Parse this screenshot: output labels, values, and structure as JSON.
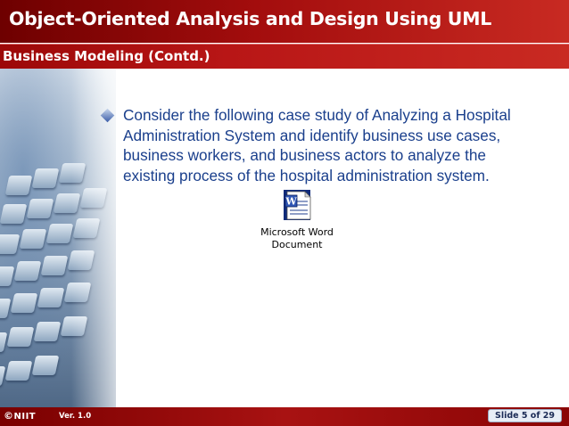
{
  "header": {
    "title": "Object-Oriented Analysis and Design Using UML",
    "subtitle": "Business Modeling (Contd.)"
  },
  "content": {
    "bullet": "Consider the following case study of Analyzing a Hospital Administration System and identify business use cases, business workers, and business actors to analyze the existing process of the hospital administration system."
  },
  "embedded_object": {
    "icon": "word-document-icon",
    "label_line1": "Microsoft Word",
    "label_line2": "Document"
  },
  "footer": {
    "logo": "NIIT",
    "logo_symbol": "©",
    "version": "Ver.  1.0",
    "slide_number": "Slide 5 of 29"
  },
  "colors": {
    "header_red": "#a30d0d",
    "footer_red": "#a81212",
    "body_text_blue": "#1a3f8c"
  }
}
